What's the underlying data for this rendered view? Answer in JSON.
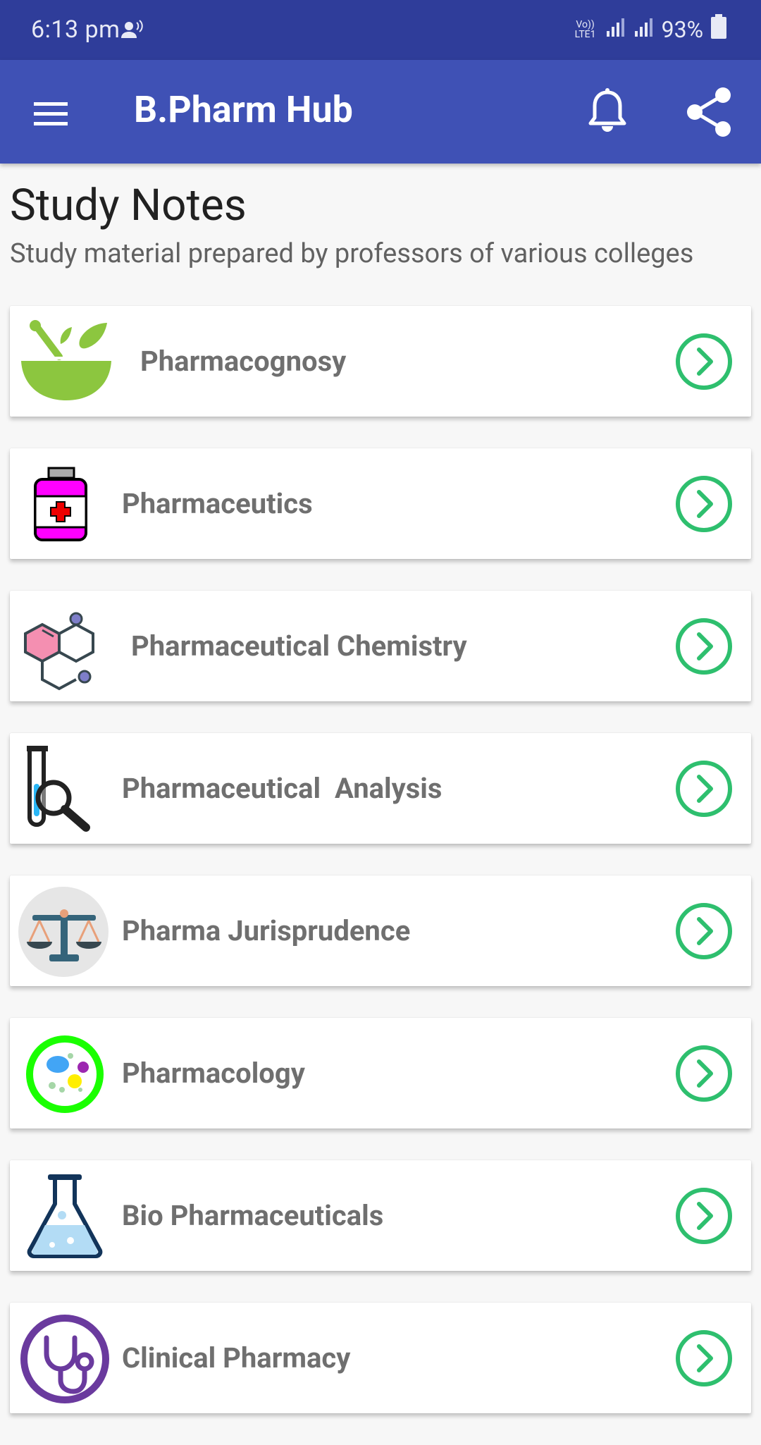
{
  "status_bar": {
    "time": "6:13 pm",
    "battery": "93%",
    "network": "Vo)) LTE1"
  },
  "app_bar": {
    "title": "B.Pharm Hub",
    "menu_icon": "hamburger-menu-icon",
    "notification_icon": "bell-icon",
    "share_icon": "share-icon"
  },
  "section": {
    "title": "Study Notes",
    "subtitle": "Study material prepared by professors of various colleges"
  },
  "subjects": [
    {
      "label": "Pharmacognosy",
      "icon": "mortar-leaf-icon"
    },
    {
      "label": "Pharmaceutics",
      "icon": "medicine-bottle-icon"
    },
    {
      "label": "Pharmaceutical Chemistry",
      "icon": "molecule-icon"
    },
    {
      "label": "Pharmaceutical  Analysis",
      "icon": "test-tube-magnifier-icon"
    },
    {
      "label": "Pharma Jurisprudence",
      "icon": "scales-icon"
    },
    {
      "label": "Pharmacology",
      "icon": "cell-icon"
    },
    {
      "label": "Bio Pharmaceuticals",
      "icon": "flask-icon"
    },
    {
      "label": "Clinical Pharmacy",
      "icon": "stethoscope-icon"
    }
  ],
  "colors": {
    "status_bar": "#2f3d9a",
    "app_bar": "#3f51b5",
    "chevron": "#2ebf6e",
    "label_text": "#6f6f6f"
  }
}
